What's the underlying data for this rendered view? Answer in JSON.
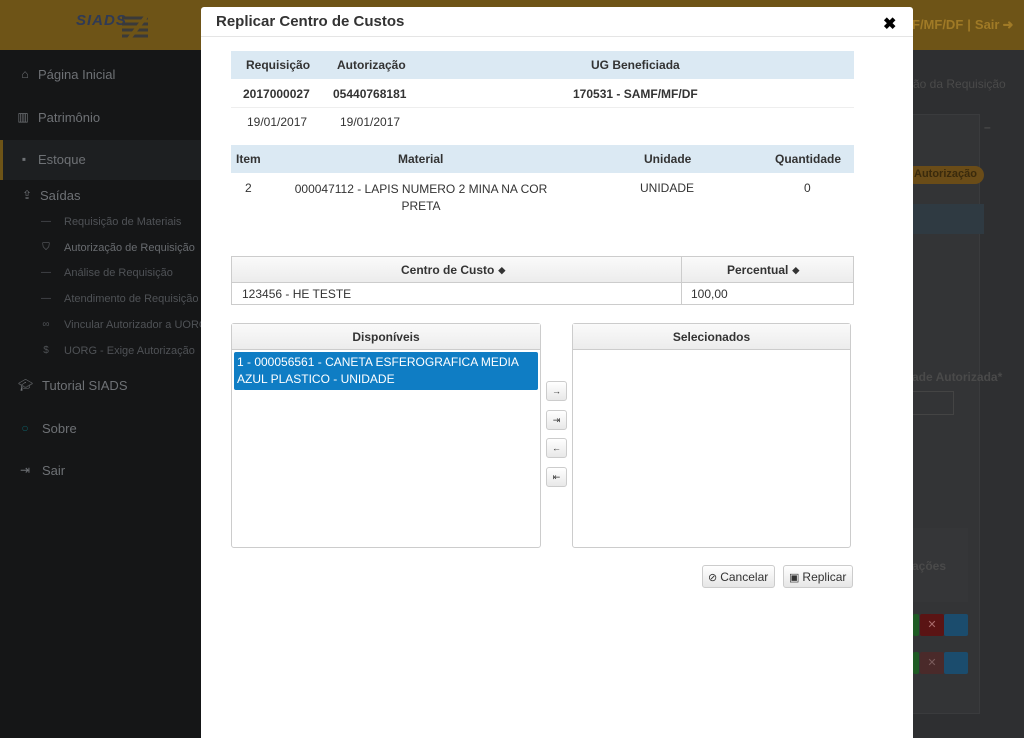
{
  "app": {
    "logo": "SIADS",
    "top_right_user": "F/MF/DF",
    "top_right_separator": "|",
    "top_right_logout": "Sair",
    "icons": {
      "logo": "siads-logo",
      "logout": "logout-icon"
    }
  },
  "sidebar": {
    "items": [
      {
        "label": "Página Inicial",
        "icon": "home-icon"
      },
      {
        "label": "Patrimônio",
        "icon": "barcode-icon"
      },
      {
        "label": "Estoque",
        "icon": "box-icon"
      },
      {
        "label": "Saídas",
        "icon": "upload-icon"
      },
      {
        "label": "Tutorial SIADS",
        "icon": "graduation-cap-icon"
      },
      {
        "label": "Sobre",
        "icon": "info-circle-icon"
      },
      {
        "label": "Sair",
        "icon": "sign-in-icon"
      }
    ],
    "sub_items": [
      {
        "label": "Requisição de Materiais",
        "icon": "dash-icon"
      },
      {
        "label": "Autorização de Requisição",
        "icon": "shield-icon"
      },
      {
        "label": "Análise de Requisição",
        "icon": "dash-icon"
      },
      {
        "label": "Atendimento de Requisição",
        "icon": "dash-icon"
      },
      {
        "label": "Vincular Autorizador a UORG",
        "icon": "link-icon"
      },
      {
        "label": "UORG - Exige Autorização",
        "icon": "dollar-icon"
      }
    ]
  },
  "background": {
    "breadcrumb_tail": "ão da Requisição",
    "badge": "Autorização",
    "qty_label": "ade Autorizada*",
    "actions_label": "ações"
  },
  "modal": {
    "title": "Replicar Centro de Custos",
    "close_icon": "close-icon",
    "requisition": {
      "headers": {
        "requisicao": "Requisição",
        "autorizacao": "Autorização",
        "ug": "UG Beneficiada"
      },
      "values": {
        "requisicao": "2017000027",
        "autorizacao": "05440768181",
        "ug": "170531 - SAMF/MF/DF"
      },
      "dates": {
        "requisicao": "19/01/2017",
        "autorizacao": "19/01/2017"
      }
    },
    "items": {
      "headers": {
        "item": "Item",
        "material": "Material",
        "unidade": "Unidade",
        "quantidade": "Quantidade"
      },
      "rows": [
        {
          "item": "2",
          "material": "000047112 - LAPIS NUMERO 2 MINA NA COR PRETA",
          "unidade": "UNIDADE",
          "quantidade": "0"
        }
      ]
    },
    "cost_center": {
      "headers": {
        "centro": "Centro de Custo",
        "percentual": "Percentual"
      },
      "sort_icon": "sort-icon",
      "rows": [
        {
          "centro": "123456 - HE TESTE",
          "percentual": "100,00"
        }
      ]
    },
    "dual_list": {
      "available_label": "Disponíveis",
      "selected_label": "Selecionados",
      "available_options": [
        "1 - 000056561 - CANETA ESFEROGRAFICA MEDIA AZUL PLASTICO - UNIDADE"
      ],
      "selected_options": [],
      "buttons": {
        "move_right": "→",
        "move_all_right": "⇥",
        "move_left": "←",
        "move_all_left": "⇤"
      }
    },
    "actions": {
      "cancel": "Cancelar",
      "replicate": "Replicar",
      "cancel_icon": "ban-icon",
      "replicate_icon": "floppy-disk-icon"
    }
  }
}
